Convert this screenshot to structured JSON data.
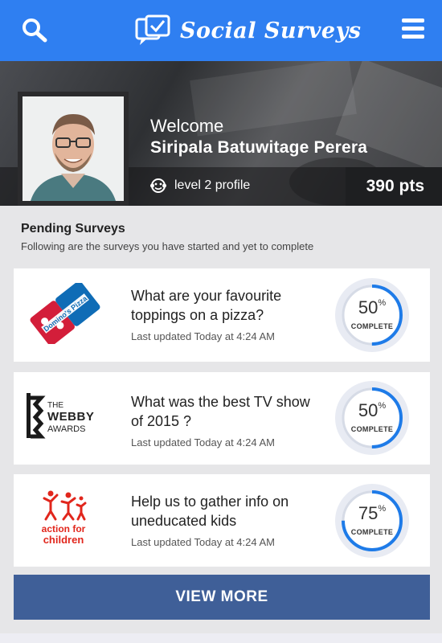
{
  "header": {
    "title": "Social Surveys",
    "search_icon": "search-icon",
    "menu_icon": "hamburger-menu-icon",
    "logo_icon": "chat-check-icon",
    "color": "#2f7ff1"
  },
  "profile": {
    "welcome": "Welcome",
    "name": "Siripala Batuwitage Perera",
    "level": "level 2 profile",
    "level_icon": "monkey-face-icon",
    "points": "390 pts"
  },
  "pending": {
    "title": "Pending Surveys",
    "subtitle": "Following are the surveys you have started and yet to complete"
  },
  "surveys": [
    {
      "logo": "dominos-pizza-logo",
      "brand_text": "Domino's Pizza",
      "question": "What are your favourite toppings on a pizza?",
      "updated": "Last updated Today at 4:24 AM",
      "progress": 50,
      "progress_text": "50",
      "progress_unit": "%",
      "complete_label": "COMPLETE"
    },
    {
      "logo": "webby-awards-logo",
      "brand_text": "THE WEBBY AWARDS",
      "question": "What was the best TV show of 2015 ?",
      "updated": "Last updated Today at 4:24 AM",
      "progress": 50,
      "progress_text": "50",
      "progress_unit": "%",
      "complete_label": "COMPLETE"
    },
    {
      "logo": "action-for-children-logo",
      "brand_text": "action for children",
      "question": "Help us to gather info on uneducated kids",
      "updated": "Last updated Today at 4:24 AM",
      "progress": 75,
      "progress_text": "75",
      "progress_unit": "%",
      "complete_label": "COMPLETE"
    }
  ],
  "view_more": "VIEW MORE",
  "colors": {
    "accent": "#2f7ff1",
    "progress_ring": "#1e7be8",
    "button": "#3f5f98"
  }
}
